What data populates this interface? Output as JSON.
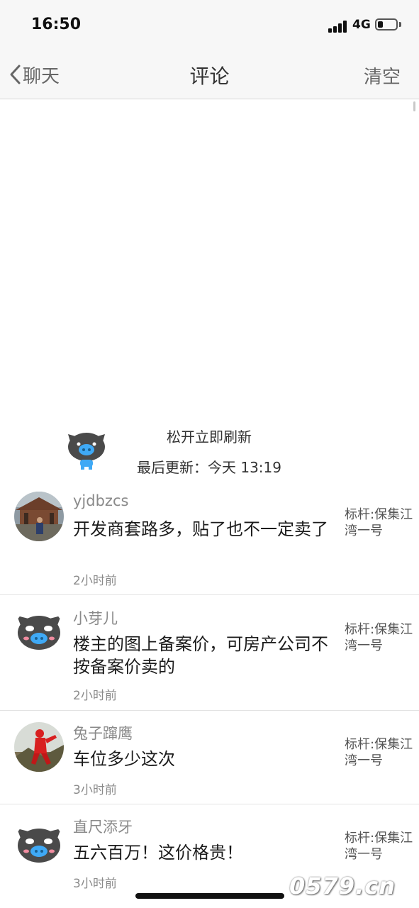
{
  "status_bar": {
    "time": "16:50",
    "network": "4G"
  },
  "nav": {
    "back_label": "聊天",
    "title": "评论",
    "clear_label": "清空"
  },
  "refresh": {
    "release_text": "松开立即刷新",
    "last_update": "最后更新：今天 13:19"
  },
  "comments": [
    {
      "username": "yjdbzcs",
      "text": "开发商套路多，贴了也不一定卖了",
      "time": "2小时前",
      "thread": "标杆:保集江湾一号",
      "avatar": "photo"
    },
    {
      "username": "小芽儿",
      "text": "楼主的图上备案价，可房产公司不按备案价卖的",
      "time": "2小时前",
      "thread": "标杆:保集江湾一号",
      "avatar": "pig"
    },
    {
      "username": "兔子蹿鹰",
      "text": "车位多少这次",
      "time": "3小时前",
      "thread": "标杆:保集江湾一号",
      "avatar": "photo"
    },
    {
      "username": "直尺添牙",
      "text": "五六百万！这价格贵！",
      "time": "3小时前",
      "thread": "标杆:保集江湾一号",
      "avatar": "pig"
    }
  ],
  "watermark": {
    "text": "0579.cn"
  },
  "colors": {
    "nav_bg": "#f7f7f7",
    "secondary_text": "#8a8a8a",
    "pig_gray": "#4a4a4a",
    "pig_blue": "#3fa9f5"
  }
}
